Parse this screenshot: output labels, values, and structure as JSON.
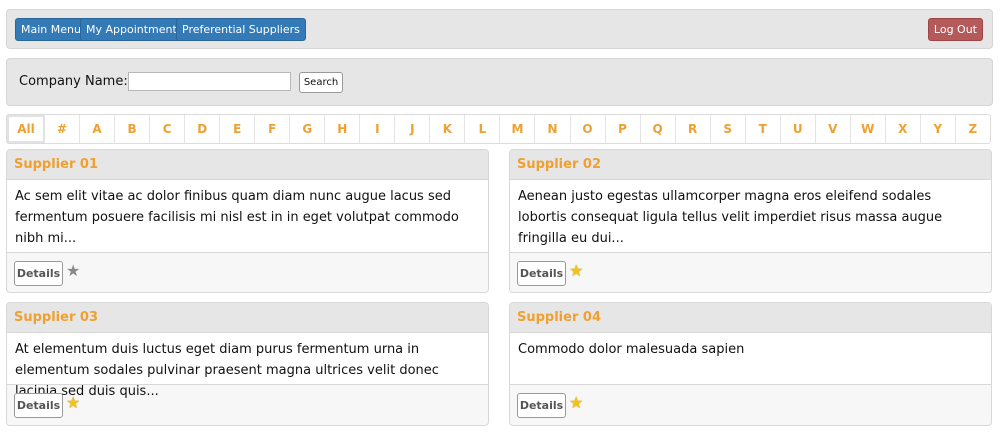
{
  "nav": {
    "main_menu": "Main Menu",
    "appointments": "My Appointments",
    "preferential": "Preferential Suppliers",
    "logout": "Log Out"
  },
  "search": {
    "label": "Company Name:",
    "value": "",
    "button": "Search"
  },
  "alphabet": [
    "All",
    "#",
    "A",
    "B",
    "C",
    "D",
    "E",
    "F",
    "G",
    "H",
    "I",
    "J",
    "K",
    "L",
    "M",
    "N",
    "O",
    "P",
    "Q",
    "R",
    "S",
    "T",
    "U",
    "V",
    "W",
    "X",
    "Y",
    "Z"
  ],
  "alphabet_active": "All",
  "colors": {
    "accent": "#f0a030",
    "nav_button": "#337ab7",
    "logout_button": "#b55a5a",
    "star_on": "#f3c21b",
    "star_off": "#8a8a8a"
  },
  "suppliers": [
    {
      "name": "Supplier 01",
      "description": "Ac sem elit vitae ac dolor finibus quam diam nunc augue lacus sed fermentum posuere facilisis mi nisl est in in eget volutpat commodo nibh mi...",
      "details_label": "Details",
      "favorite": false,
      "star_icon": "star-empty-icon"
    },
    {
      "name": "Supplier 02",
      "description": "Aenean justo egestas ullamcorper magna eros eleifend sodales lobortis consequat ligula tellus velit imperdiet risus massa augue fringilla eu dui...",
      "details_label": "Details",
      "favorite": true,
      "star_icon": "star-filled-icon"
    },
    {
      "name": "Supplier 03",
      "description": "At elementum duis luctus eget diam purus fermentum urna in elementum sodales pulvinar praesent magna ultrices velit donec lacinia sed duis quis...",
      "details_label": "Details",
      "favorite": true,
      "star_icon": "star-filled-icon"
    },
    {
      "name": "Supplier 04",
      "description": "Commodo dolor malesuada sapien",
      "details_label": "Details",
      "favorite": true,
      "star_icon": "star-filled-icon"
    }
  ]
}
